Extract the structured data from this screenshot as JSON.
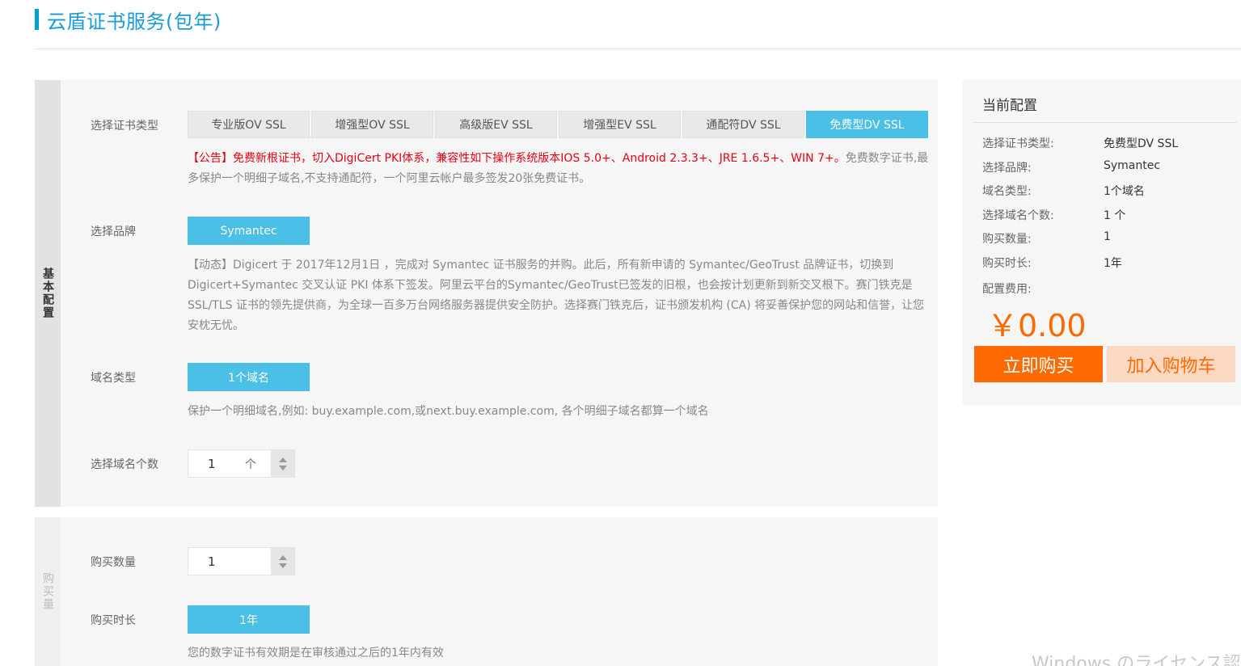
{
  "page": {
    "title": "云盾证书服务(包年)"
  },
  "basic_section": {
    "side_label": "基本配置",
    "cert_type": {
      "label": "选择证书类型",
      "tabs": [
        "专业版OV SSL",
        "增强型OV SSL",
        "高级版EV SSL",
        "增强型EV SSL",
        "通配符DV SSL",
        "免费型DV SSL"
      ],
      "selected_index": 5,
      "notice_red": "【公告】免费新根证书，切入DigiCert PKI体系，兼容性如下操作系统版本IOS 5.0+、Android 2.3.3+、JRE 1.6.5+、WIN 7+。",
      "notice_gray": "免费数字证书,最多保护一个明细子域名,不支持通配符，一个阿里云帐户最多签发20张免费证书。"
    },
    "brand": {
      "label": "选择品牌",
      "value": "Symantec",
      "notice": "【动态】Digicert 于 2017年12月1日 ，完成对 Symantec 证书服务的并购。此后，所有新申请的 Symantec/GeoTrust 品牌证书，切换到 Digicert+Symantec 交叉认证 PKI 体系下签发。阿里云平台的Symantec/GeoTrust已签发的旧根，也会按计划更新到新交叉根下。赛门铁克是 SSL/TLS 证书的领先提供商，为全球一百多万台网络服务器提供安全防护。选择赛门铁克后，证书颁发机构 (CA) 将妥善保护您的网站和信誉，让您安枕无忧。"
    },
    "domain_type": {
      "label": "域名类型",
      "value": "1个域名",
      "notice": "保护一个明细域名,例如: buy.example.com,或next.buy.example.com, 各个明细子域名都算一个域名"
    },
    "domain_count": {
      "label": "选择域名个数",
      "value": "1",
      "unit": "个"
    }
  },
  "purchase_section": {
    "side_label": "购买量",
    "quantity": {
      "label": "购买数量",
      "value": "1"
    },
    "duration": {
      "label": "购买时长",
      "value": "1年",
      "notice": "您的数字证书有效期是在审核通过之后的1年内有效"
    }
  },
  "summary": {
    "title": "当前配置",
    "rows": [
      {
        "key": "选择证书类型:",
        "value": "免费型DV SSL"
      },
      {
        "key": "选择品牌:",
        "value": "Symantec"
      },
      {
        "key": "域名类型:",
        "value": "1个域名"
      },
      {
        "key": "选择域名个数:",
        "value": "1 个"
      },
      {
        "key": "购买数量:",
        "value": "1"
      },
      {
        "key": "购买时长:",
        "value": "1年"
      }
    ],
    "fee_label": "配置费用:",
    "price": "￥0.00",
    "buy_label": "立即购买",
    "cart_label": "加入购物车"
  },
  "watermark": "Windows のライセンス認証",
  "colors": {
    "accent_blue": "#4ac0e6",
    "title_blue": "#1a9bd7",
    "price_orange": "#ff6a00",
    "notice_red": "#e60012"
  }
}
